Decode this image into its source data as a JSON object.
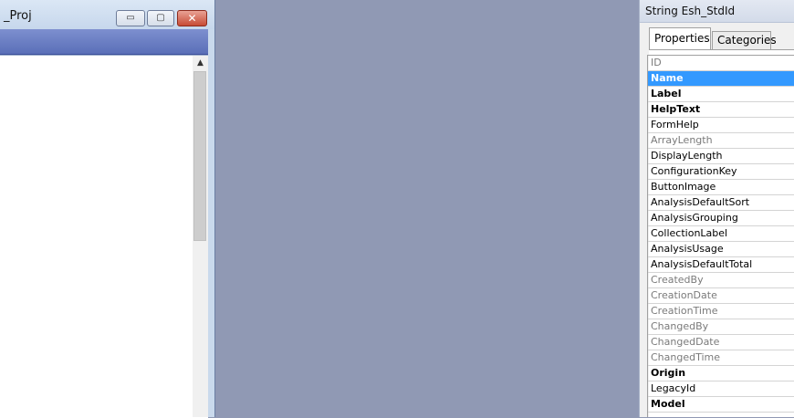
{
  "left_window": {
    "title": "_Proj",
    "buttons": {
      "minimize": "▭",
      "maximize": "▢",
      "close": "✕"
    }
  },
  "right_window": {
    "title": "String Esh_StdId",
    "tabs": [
      {
        "label": "Properties",
        "active": true
      },
      {
        "label": "Categories",
        "active": false
      }
    ],
    "properties": [
      {
        "name": "ID",
        "style": "grey"
      },
      {
        "name": "Name",
        "style": "selected"
      },
      {
        "name": "Label",
        "style": "bold"
      },
      {
        "name": "HelpText",
        "style": "bold"
      },
      {
        "name": "FormHelp",
        "style": "normal"
      },
      {
        "name": "ArrayLength",
        "style": "grey"
      },
      {
        "name": "DisplayLength",
        "style": "normal"
      },
      {
        "name": "ConfigurationKey",
        "style": "normal"
      },
      {
        "name": "ButtonImage",
        "style": "normal"
      },
      {
        "name": "AnalysisDefaultSort",
        "style": "normal"
      },
      {
        "name": "AnalysisGrouping",
        "style": "normal"
      },
      {
        "name": "CollectionLabel",
        "style": "normal"
      },
      {
        "name": "AnalysisUsage",
        "style": "normal"
      },
      {
        "name": "AnalysisDefaultTotal",
        "style": "normal"
      },
      {
        "name": "CreatedBy",
        "style": "grey"
      },
      {
        "name": "CreationDate",
        "style": "grey"
      },
      {
        "name": "CreationTime",
        "style": "grey"
      },
      {
        "name": "ChangedBy",
        "style": "grey"
      },
      {
        "name": "ChangedDate",
        "style": "grey"
      },
      {
        "name": "ChangedTime",
        "style": "grey"
      },
      {
        "name": "Origin",
        "style": "bold"
      },
      {
        "name": "LegacyId",
        "style": "normal"
      },
      {
        "name": "Model",
        "style": "bold"
      }
    ]
  },
  "colors": {
    "desktop": "#9099b4",
    "selection": "#3399ff",
    "close_button": "#c74b35"
  }
}
